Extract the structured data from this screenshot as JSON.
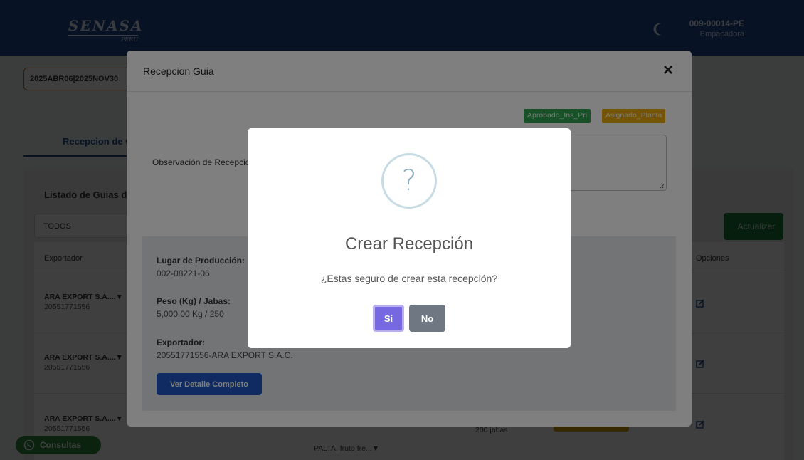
{
  "header": {
    "logo_text": "SENASA",
    "logo_sub": "PERU",
    "user_code": "009-00014-PE",
    "user_role": "Empacadora"
  },
  "page": {
    "period_select": "2025ABR06|2025NOV30",
    "tab_label": "Recepcion de Guias",
    "list_title": "Listado de Guias de Remision",
    "filter_value": "TODOS",
    "refresh_label": "Actualizar",
    "table": {
      "headers": {
        "exporter": "Exportador",
        "options": "Opciones"
      },
      "rows": [
        {
          "exporter_name": "ARA EXPORT S.A....▼",
          "exporter_ruc": "20551771556"
        },
        {
          "exporter_name": "ARA EXPORT S.A....▼",
          "exporter_ruc": "20551771556"
        },
        {
          "exporter_name": "ARA EXPORT S.A....▼",
          "exporter_ruc": "20551771556"
        }
      ],
      "product_text": "PALTA, fruto fre...▼",
      "jabas_text": "200 jabas"
    },
    "consultas_label": "Consultas"
  },
  "modal": {
    "title": "Recepcion Guia",
    "close": "×",
    "badges": [
      "Aprobado_Ins_Pri",
      "Asignado_Planta"
    ],
    "observation_label": "Observación de Recepción:",
    "info": {
      "lugar_label": "Lugar de Producción:",
      "lugar_value": "002-08221-06",
      "peso_label": "Peso (Kg) / Jabas:",
      "peso_value": "5,000.00 Kg / 250",
      "exportador_label": "Exportador:",
      "exportador_value": "20551771556-ARA EXPORT S.A.C."
    },
    "detail_button": "Ver Detalle Completo"
  },
  "dialog": {
    "icon_mark": "?",
    "title": "Crear Recepción",
    "text": "¿Estas seguro de crear esta recepción?",
    "yes": "Si",
    "no": "No"
  },
  "colors": {
    "header_blue": "#1f4e94",
    "confirm_purple": "#7668e0",
    "cancel_gray": "#6f7782",
    "badge_green": "#2ea34f",
    "badge_yellow": "#eca90d",
    "detail_blue": "#1e57c4"
  }
}
